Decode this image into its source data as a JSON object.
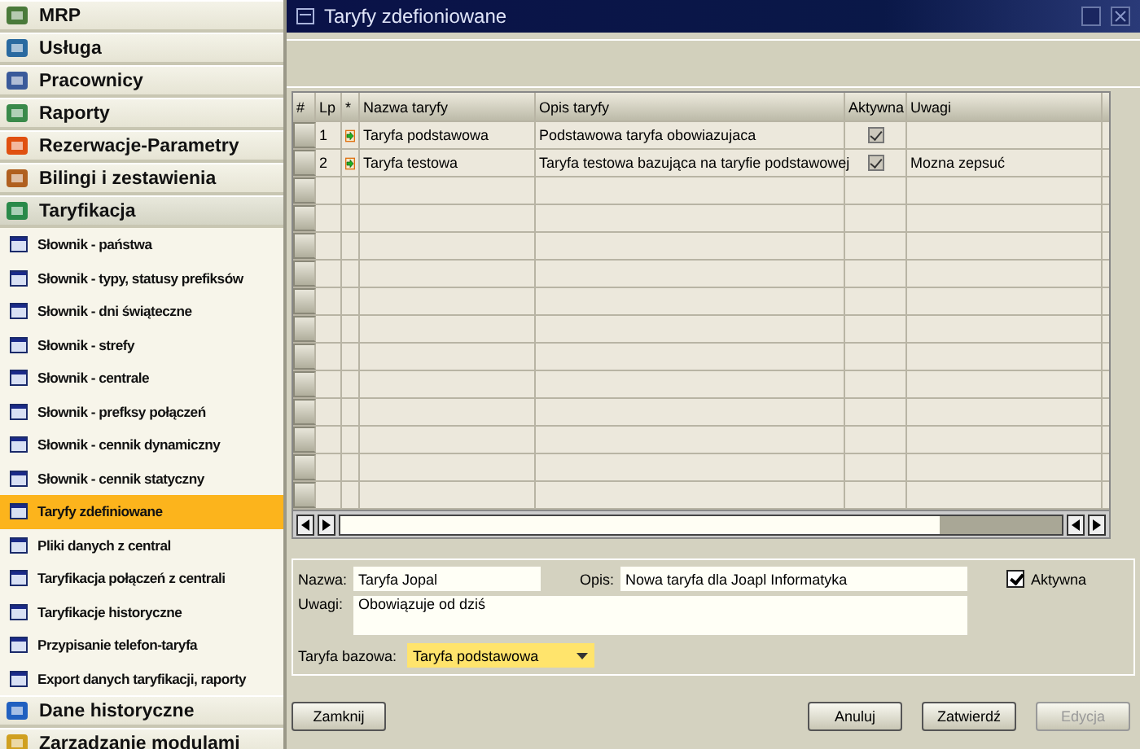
{
  "sidebar": {
    "items": [
      {
        "kind": "group",
        "label": "MRP",
        "selected": false
      },
      {
        "kind": "group",
        "label": "Usługa",
        "selected": false
      },
      {
        "kind": "group",
        "label": "Pracownicy",
        "selected": false
      },
      {
        "kind": "group",
        "label": "Raporty",
        "selected": false
      },
      {
        "kind": "group",
        "label": "Rezerwacje-Parametry",
        "selected": false
      },
      {
        "kind": "group",
        "label": "Bilingi i zestawienia",
        "selected": false
      },
      {
        "kind": "group",
        "label": "Taryfikacja",
        "selected": true
      },
      {
        "kind": "item",
        "label": "Słownik - państwa",
        "selected": false
      },
      {
        "kind": "item",
        "label": "Słownik - typy, statusy prefiksów",
        "selected": false
      },
      {
        "kind": "item",
        "label": "Słownik - dni świąteczne",
        "selected": false
      },
      {
        "kind": "item",
        "label": "Słownik - strefy",
        "selected": false
      },
      {
        "kind": "item",
        "label": "Słownik - centrale",
        "selected": false
      },
      {
        "kind": "item",
        "label": "Słownik - prefksy połączeń",
        "selected": false
      },
      {
        "kind": "item",
        "label": "Słownik - cennik dynamiczny",
        "selected": false
      },
      {
        "kind": "item",
        "label": "Słownik - cennik statyczny",
        "selected": false
      },
      {
        "kind": "item",
        "label": "Taryfy zdefiniowane",
        "selected": true
      },
      {
        "kind": "item",
        "label": "Pliki danych z central",
        "selected": false
      },
      {
        "kind": "item",
        "label": "Taryfikacja połączeń z centrali",
        "selected": false
      },
      {
        "kind": "item",
        "label": "Taryfikacje historyczne",
        "selected": false
      },
      {
        "kind": "item",
        "label": "Przypisanie telefon-taryfa",
        "selected": false
      },
      {
        "kind": "item",
        "label": "Export danych taryfikacji, raporty",
        "selected": false
      },
      {
        "kind": "group",
        "label": "Dane historyczne",
        "selected": false
      },
      {
        "kind": "group",
        "label": "Zarzadzanie modulami",
        "selected": false
      }
    ]
  },
  "window": {
    "title": "Taryfy zdefioniowane"
  },
  "table": {
    "columns": [
      "#",
      "Lp",
      "*",
      "Nazwa taryfy",
      "Opis taryfy",
      "Aktywna",
      "Uwagi"
    ],
    "rows": [
      {
        "lp": "1",
        "name": "Taryfa podstawowa",
        "description": "Podstawowa taryfa obowiazujaca",
        "active": true,
        "notes": ""
      },
      {
        "lp": "2",
        "name": "Taryfa testowa",
        "description": "Taryfa testowa bazująca na taryfie  podstawowej",
        "active": true,
        "notes": "Mozna zepsuć"
      }
    ]
  },
  "form": {
    "name_label": "Nazwa:",
    "name_value": "Taryfa Jopal",
    "description_label": "Opis:",
    "description_value": "Nowa taryfa dla Joapl Informatyka",
    "active_label": "Aktywna",
    "active": true,
    "notes_label": "Uwagi:",
    "notes_value": "Obowiązuje od dziś",
    "base_label": "Taryfa bazowa:",
    "base_value": "Taryfa podstawowa"
  },
  "buttons": [
    {
      "label": "Zamknij",
      "disabled": false
    },
    {
      "label": "Anuluj",
      "disabled": false
    },
    {
      "label": "Zatwierdź",
      "disabled": false
    },
    {
      "label": "Edycja",
      "disabled": true
    }
  ]
}
